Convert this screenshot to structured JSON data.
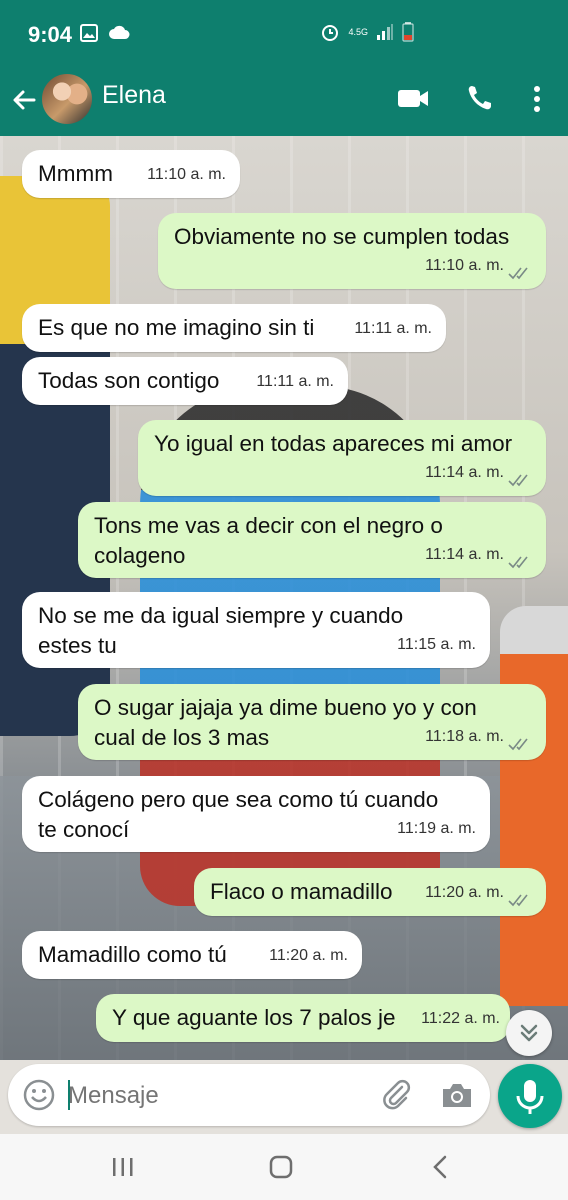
{
  "status_bar": {
    "time": "9:04",
    "network": "4.5G",
    "icons": [
      "image-icon",
      "cloud-icon",
      "alarm-icon",
      "network-icon",
      "signal-icon",
      "battery-icon"
    ]
  },
  "header": {
    "contact_name": "Elena",
    "icons": [
      "back-arrow-icon",
      "avatar",
      "video-call-icon",
      "phone-icon",
      "more-vert-icon"
    ]
  },
  "messages": [
    {
      "direction": "in",
      "text": "Mmmm",
      "time": "11:10 a. m."
    },
    {
      "direction": "out",
      "text": "Obviamente no se cumplen todas",
      "time": "11:10 a. m.",
      "read": true
    },
    {
      "direction": "in",
      "text": "Es que no me imagino sin ti",
      "time": "11:11 a. m."
    },
    {
      "direction": "in",
      "text": "Todas son contigo",
      "time": "11:11 a. m."
    },
    {
      "direction": "out",
      "text": "Yo igual en todas apareces mi amor",
      "time": "11:14 a. m.",
      "read": true
    },
    {
      "direction": "out",
      "text": "Tons me vas a decir con el negro o\ncolageno",
      "time": "11:14 a. m.",
      "read": true
    },
    {
      "direction": "in",
      "text": "No se me da igual siempre y cuando\nestes tu",
      "time": "11:15 a. m."
    },
    {
      "direction": "out",
      "text": "O sugar jajaja ya dime bueno yo y con\ncual de los 3 mas",
      "time": "11:18 a. m.",
      "read": true
    },
    {
      "direction": "in",
      "text": "Colágeno pero que sea como tú cuando\nte conocí",
      "time": "11:19 a. m."
    },
    {
      "direction": "out",
      "text": "Flaco o mamadillo",
      "time": "11:20 a. m.",
      "read": true
    },
    {
      "direction": "in",
      "text": "Mamadillo como tú",
      "time": "11:20 a. m."
    },
    {
      "direction": "out",
      "text": "Y que aguante los 7 palos je",
      "time": "11:22 a. m.",
      "read": false
    }
  ],
  "composer": {
    "placeholder": "Mensaje"
  },
  "colors": {
    "header": "#0e7f6e",
    "outgoing_bubble": "#dcf8c6",
    "incoming_bubble": "#ffffff",
    "mic_button": "#0aa58a",
    "read_ticks": "#7a8a86"
  }
}
